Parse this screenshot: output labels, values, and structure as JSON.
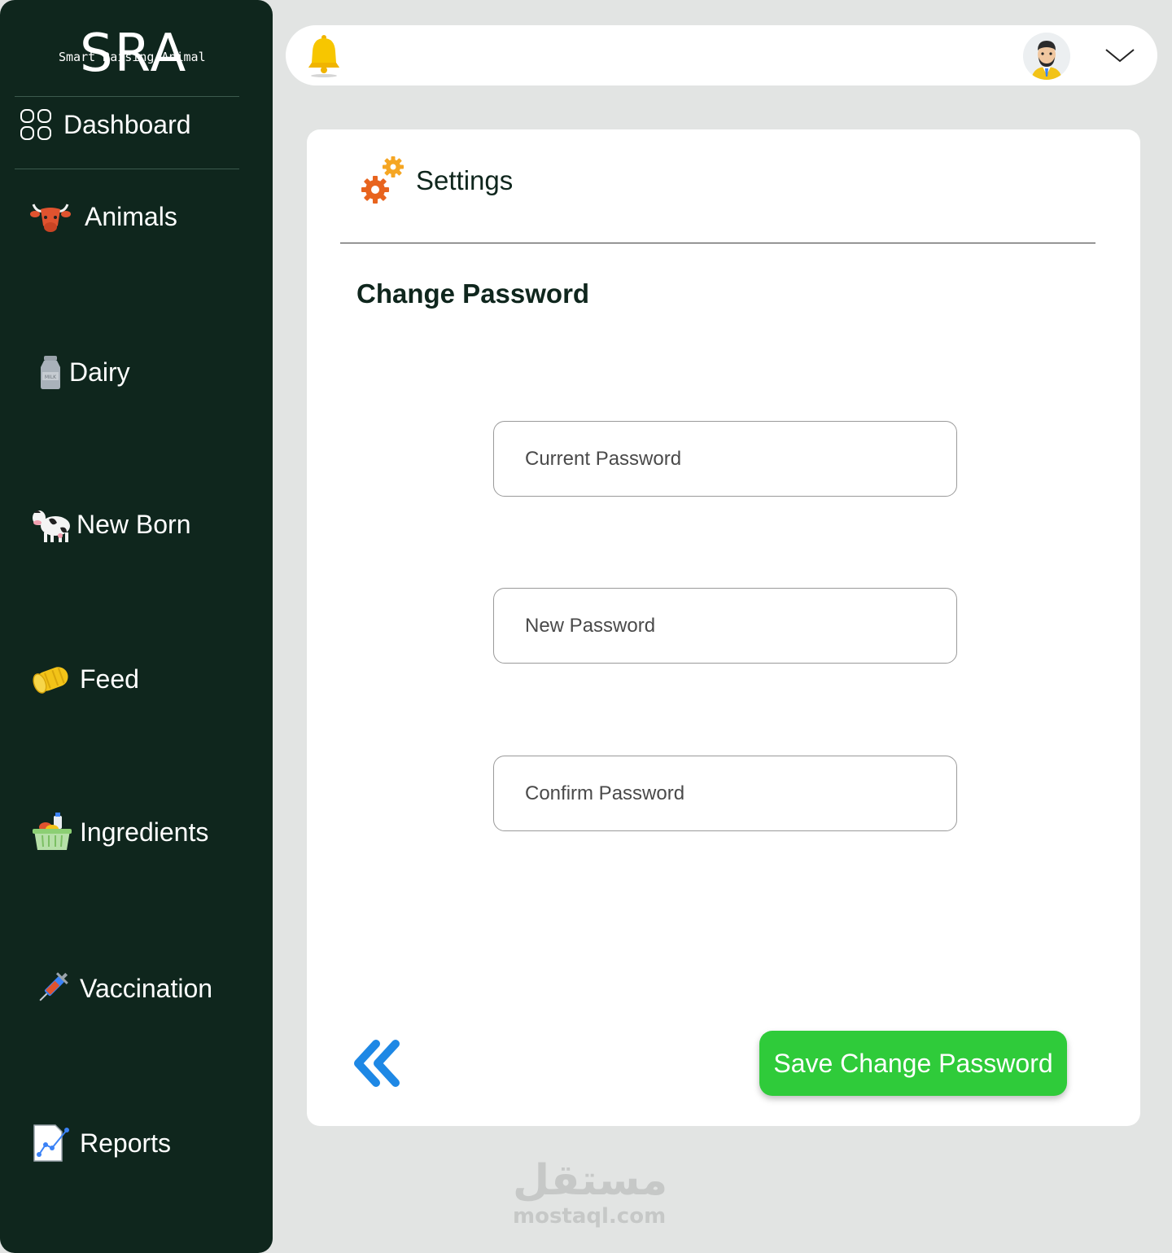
{
  "brand": {
    "logo_text": "SRA",
    "tagline": "Smart Raising Animal"
  },
  "sidebar": {
    "items": [
      {
        "label": "Dashboard",
        "icon": "grid-icon"
      },
      {
        "label": "Animals",
        "icon": "bull-head-icon"
      },
      {
        "label": "Dairy",
        "icon": "milk-can-icon"
      },
      {
        "label": "New Born",
        "icon": "cow-icon"
      },
      {
        "label": "Feed",
        "icon": "hay-bale-icon"
      },
      {
        "label": "Ingredients",
        "icon": "basket-icon"
      },
      {
        "label": "Vaccination",
        "icon": "syringe-icon"
      },
      {
        "label": "Reports",
        "icon": "report-chart-icon"
      }
    ]
  },
  "header": {
    "notification_icon": "bell-icon",
    "avatar_icon": "user-avatar-icon",
    "menu_icon": "chevron-down-icon"
  },
  "settings": {
    "title": "Settings",
    "section_title": "Change Password",
    "fields": {
      "current_placeholder": "Current Password",
      "new_placeholder": "New Password",
      "confirm_placeholder": "Confirm Password"
    },
    "save_label": "Save Change Password",
    "back_icon": "double-chevron-left-icon"
  },
  "watermark": {
    "arabic": "مستقل",
    "latin": "mostaql.com"
  },
  "colors": {
    "sidebar_bg": "#0f261d",
    "page_bg": "#e2e4e3",
    "save_button": "#2fcb3a",
    "back_arrow": "#1e88e5",
    "gear_orange": "#e8641e",
    "gear_yellow": "#f5a623"
  }
}
